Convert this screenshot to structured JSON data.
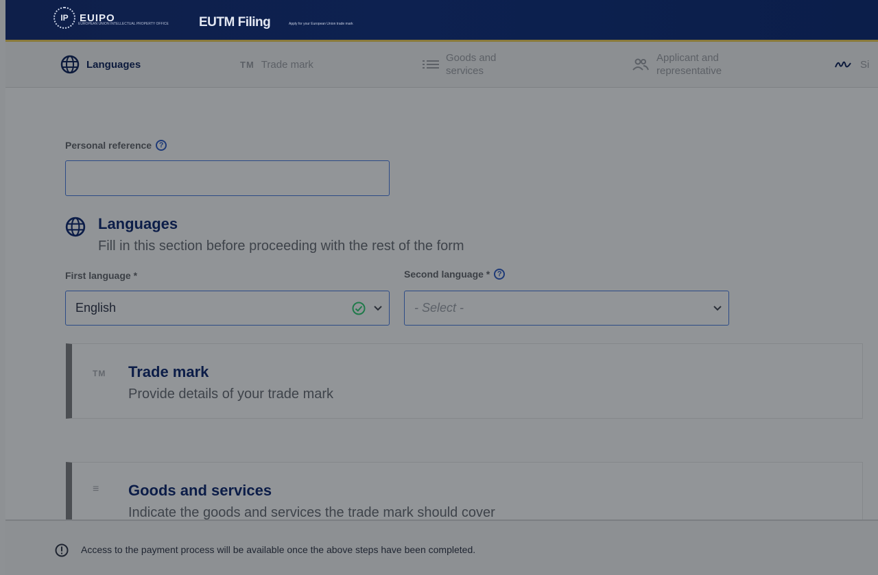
{
  "header": {
    "logo_text": "EUIPO",
    "logo_subtext": "EUROPEAN UNION INTELLECTUAL PROPERTY OFFICE",
    "app_title": "EUTM Filing",
    "app_subtitle": "Apply for your European Union trade mark"
  },
  "steps": [
    {
      "label": "Languages",
      "icon": "globe-icon",
      "active": true
    },
    {
      "label": "Trade mark",
      "icon": "tm-icon",
      "active": false
    },
    {
      "label": "Goods and services",
      "line1": "Goods and",
      "line2": "services",
      "icon": "list-icon",
      "active": false
    },
    {
      "label": "Applicant and representative",
      "line1": "Applicant and",
      "line2": "representative",
      "icon": "people-icon",
      "active": false
    },
    {
      "label": "Si",
      "icon": "signature-icon",
      "active": false
    }
  ],
  "form": {
    "personal_reference": {
      "label": "Personal reference",
      "value": ""
    },
    "languages_section": {
      "title": "Languages",
      "description": "Fill in this section before proceeding with the rest of the form"
    },
    "first_language": {
      "label": "First language *",
      "value": "English"
    },
    "second_language": {
      "label": "Second language *",
      "placeholder": "- Select -"
    }
  },
  "cards": [
    {
      "badge": "TM",
      "title": "Trade mark",
      "description": "Provide details of your trade mark"
    },
    {
      "badge": "≡",
      "title": "Goods and services",
      "description": "Indicate the goods and services the trade mark should cover"
    }
  ],
  "footer": {
    "message": "Access to the payment process will be available once the above steps have been completed."
  },
  "colors": {
    "header_bg": "#0e1f4a",
    "accent_blue": "#1e3a78",
    "valid_green": "#1f7a4a",
    "overlay_gray": "#919497"
  }
}
